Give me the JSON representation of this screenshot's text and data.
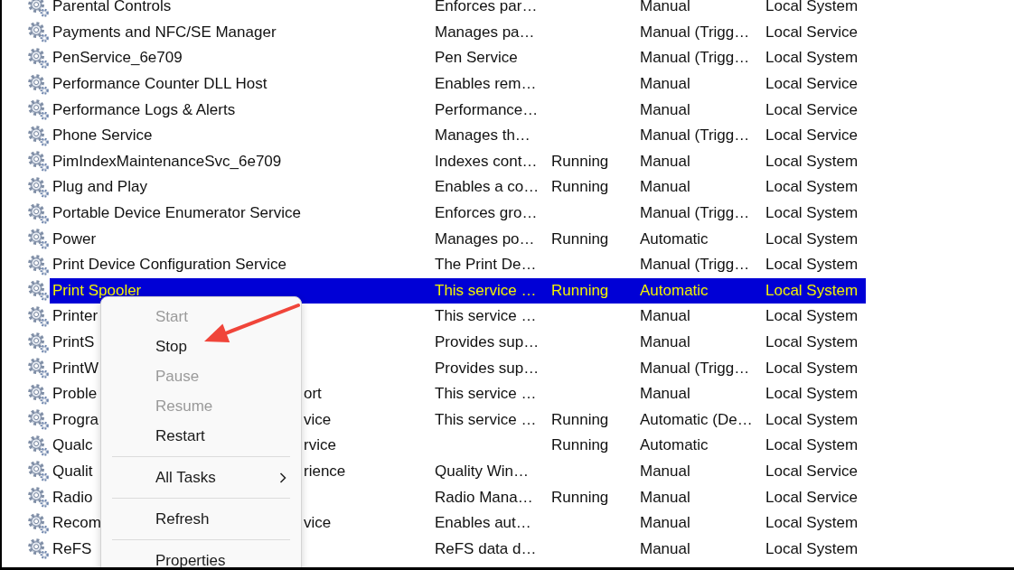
{
  "services": [
    {
      "name": "Parental Controls",
      "description": "Enforces par…",
      "startup_type": "Manual",
      "log_on_as": "Local System",
      "selected": false
    },
    {
      "name": "Payments and NFC/SE Manager",
      "description": "Manages pa…",
      "startup_type": "Manual (Trigg…",
      "log_on_as": "Local Service",
      "selected": false
    },
    {
      "name": "PenService_6e709",
      "description": "Pen Service",
      "startup_type": "Manual (Trigg…",
      "log_on_as": "Local System",
      "selected": false
    },
    {
      "name": "Performance Counter DLL Host",
      "description": "Enables rem…",
      "startup_type": "Manual",
      "log_on_as": "Local Service",
      "selected": false
    },
    {
      "name": "Performance Logs & Alerts",
      "description": "Performance…",
      "startup_type": "Manual",
      "log_on_as": "Local Service",
      "selected": false
    },
    {
      "name": "Phone Service",
      "description": "Manages th…",
      "startup_type": "Manual (Trigg…",
      "log_on_as": "Local Service",
      "selected": false
    },
    {
      "name": "PimIndexMaintenanceSvc_6e709",
      "description": "Indexes cont…",
      "status": "Running",
      "startup_type": "Manual",
      "log_on_as": "Local System",
      "selected": false
    },
    {
      "name": "Plug and Play",
      "description": "Enables a co…",
      "status": "Running",
      "startup_type": "Manual",
      "log_on_as": "Local System",
      "selected": false
    },
    {
      "name": "Portable Device Enumerator Service",
      "description": "Enforces gro…",
      "startup_type": "Manual (Trigg…",
      "log_on_as": "Local System",
      "selected": false
    },
    {
      "name": "Power",
      "description": "Manages po…",
      "status": "Running",
      "startup_type": "Automatic",
      "log_on_as": "Local System",
      "selected": false
    },
    {
      "name": "Print Device Configuration Service",
      "description": "The Print De…",
      "startup_type": "Manual (Trigg…",
      "log_on_as": "Local System",
      "selected": false
    },
    {
      "name": "Print Spooler",
      "description": "This service …",
      "status": "Running",
      "startup_type": "Automatic",
      "log_on_as": "Local System",
      "selected": true
    },
    {
      "name": "Printer",
      "description": "This service …",
      "startup_type": "Manual",
      "log_on_as": "Local System",
      "selected": false
    },
    {
      "name": "PrintS",
      "description": "Provides sup…",
      "startup_type": "Manual",
      "log_on_as": "Local System",
      "selected": false
    },
    {
      "name": "PrintW",
      "description": "Provides sup…",
      "startup_type": "Manual (Trigg…",
      "log_on_as": "Local System",
      "selected": false
    },
    {
      "name": "Proble",
      "name_tail": "ort",
      "description": "This service …",
      "startup_type": "Manual",
      "log_on_as": "Local System",
      "selected": false
    },
    {
      "name": "Progra",
      "name_tail": "vice",
      "description": "This service …",
      "status": "Running",
      "startup_type": "Automatic (De…",
      "log_on_as": "Local System",
      "selected": false
    },
    {
      "name": "Qualc",
      "name_tail": "rvice",
      "status": "Running",
      "startup_type": "Automatic",
      "log_on_as": "Local System",
      "selected": false
    },
    {
      "name": "Qualit",
      "name_tail": "rience",
      "description": "Quality Win…",
      "startup_type": "Manual",
      "log_on_as": "Local Service",
      "selected": false
    },
    {
      "name": "Radio",
      "description": "Radio Mana…",
      "status": "Running",
      "startup_type": "Manual",
      "log_on_as": "Local Service",
      "selected": false
    },
    {
      "name": "Recom",
      "name_tail": "vice",
      "description": "Enables aut…",
      "startup_type": "Manual",
      "log_on_as": "Local System",
      "selected": false
    },
    {
      "name": "ReFS",
      "description": "ReFS data d…",
      "startup_type": "Manual",
      "log_on_as": "Local System",
      "selected": false
    }
  ],
  "context_menu": {
    "items": [
      {
        "kind": "item",
        "label": "Start",
        "disabled": true
      },
      {
        "kind": "item",
        "label": "Stop",
        "disabled": false
      },
      {
        "kind": "item",
        "label": "Pause",
        "disabled": true
      },
      {
        "kind": "item",
        "label": "Resume",
        "disabled": true
      },
      {
        "kind": "item",
        "label": "Restart",
        "disabled": false
      },
      {
        "kind": "separator"
      },
      {
        "kind": "submenu",
        "label": "All Tasks",
        "disabled": false
      },
      {
        "kind": "separator"
      },
      {
        "kind": "item",
        "label": "Refresh",
        "disabled": false
      },
      {
        "kind": "separator"
      },
      {
        "kind": "item",
        "label": "Properties",
        "disabled": false
      }
    ]
  }
}
